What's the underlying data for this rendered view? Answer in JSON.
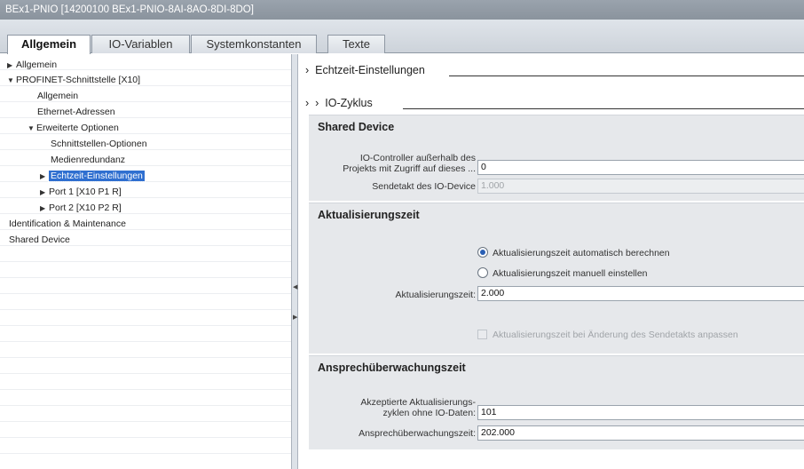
{
  "window": {
    "title": "BEx1-PNIO [14200100 BEx1-PNIO-8AI-8AO-8DI-8DO]"
  },
  "tabs": [
    {
      "label": "Allgemein",
      "active": true
    },
    {
      "label": "IO-Variablen",
      "active": false
    },
    {
      "label": "Systemkonstanten",
      "active": false
    },
    {
      "label": "Texte",
      "active": false
    }
  ],
  "tree": [
    {
      "label": "Allgemein",
      "arrow": "▶"
    },
    {
      "label": "PROFINET-Schnittstelle [X10]",
      "arrow": "▼"
    },
    {
      "label": "Allgemein",
      "arrow": ""
    },
    {
      "label": "Ethernet-Adressen",
      "arrow": ""
    },
    {
      "label": "Erweiterte Optionen",
      "arrow": "▼"
    },
    {
      "label": "Schnittstellen-Optionen",
      "arrow": ""
    },
    {
      "label": "Medienredundanz",
      "arrow": ""
    },
    {
      "label": "Echtzeit-Einstellungen",
      "arrow": "▶",
      "selected": true
    },
    {
      "label": "Port 1 [X10 P1 R]",
      "arrow": "▶"
    },
    {
      "label": "Port 2 [X10 P2 R]",
      "arrow": "▶"
    },
    {
      "label": "Identification & Maintenance",
      "arrow": ""
    },
    {
      "label": "Shared Device",
      "arrow": ""
    }
  ],
  "content": {
    "section_main": "Echtzeit-Einstellungen",
    "section_sub": "IO-Zyklus",
    "arrow": "›",
    "shared_device": {
      "title": "Shared Device",
      "controller_label_1": "IO-Controller außerhalb des",
      "controller_label_2": "Projekts mit Zugriff auf dieses ...",
      "controller_value": "0",
      "sendetakt_label": "Sendetakt des IO-Device",
      "sendetakt_value": "1.000"
    },
    "aktualisierung": {
      "title": "Aktualisierungszeit",
      "radio_auto": "Aktualisierungszeit automatisch berechnen",
      "radio_manual": "Aktualisierungszeit manuell einstellen",
      "field_label": "Aktualisierungszeit:",
      "field_value": "2.000",
      "checkbox_label": "Aktualisierungszeit bei Änderung des Sendetakts anpassen"
    },
    "ansprech": {
      "title": "Ansprechüberwachungszeit",
      "cycles_label_1": "Akzeptierte Aktualisierungs-",
      "cycles_label_2": "zyklen ohne IO-Daten:",
      "cycles_value": "101",
      "watch_label": "Ansprechüberwachungszeit:",
      "watch_value": "202.000"
    }
  },
  "colors": {
    "selection": "#2f6fd0",
    "panel": "#e6e8eb",
    "titlebar": "#8a939d"
  }
}
